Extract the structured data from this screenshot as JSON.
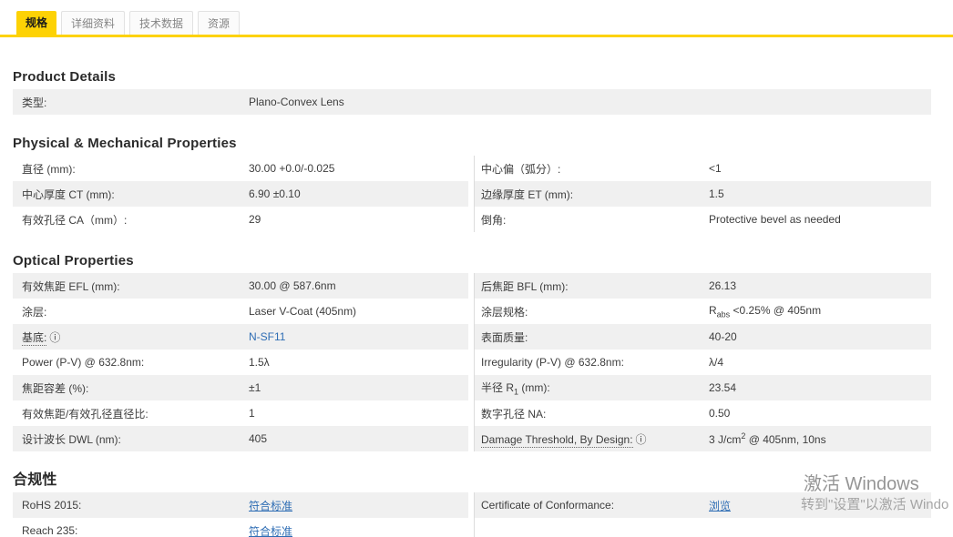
{
  "tabs": {
    "specs": "规格",
    "details": "详细资料",
    "tech_data": "技术数据",
    "resources": "资源"
  },
  "icons": {
    "info": "ⓘ"
  },
  "product_details": {
    "heading": "Product Details",
    "rows": [
      {
        "label": "类型:",
        "value": "Plano-Convex Lens"
      }
    ]
  },
  "physical": {
    "heading": "Physical & Mechanical Properties",
    "left": [
      {
        "label": "直径 (mm):",
        "value": "30.00 +0.0/-0.025"
      },
      {
        "label": "中心厚度 CT (mm):",
        "value": "6.90 ±0.10"
      },
      {
        "label": "有效孔径 CA（mm）:",
        "value": "29"
      }
    ],
    "right": [
      {
        "label": "中心偏（弧分）:",
        "value": "<1"
      },
      {
        "label": "边缘厚度 ET (mm):",
        "value": "1.5"
      },
      {
        "label": "倒角:",
        "value": "Protective bevel as needed"
      }
    ]
  },
  "optical": {
    "heading": "Optical Properties",
    "left": [
      {
        "label": "有效焦距 EFL (mm):",
        "value": "30.00 @ 587.6nm"
      },
      {
        "label": "涂层:",
        "value": "Laser V-Coat (405nm)"
      },
      {
        "label": "基底:",
        "value": "N-SF11"
      },
      {
        "label": "Power (P-V) @ 632.8nm:",
        "value": "1.5λ"
      },
      {
        "label": "焦距容差 (%):",
        "value": "±1"
      },
      {
        "label": "有效焦距/有效孔径直径比:",
        "value": "1"
      },
      {
        "label": "设计波长 DWL (nm):",
        "value": "405"
      }
    ],
    "right": [
      {
        "label": "后焦距 BFL (mm):",
        "value": "26.13"
      },
      {
        "label": "涂层规格:",
        "value_pre": "R",
        "value_sub": "abs",
        "value_post": " <0.25% @ 405nm"
      },
      {
        "label": "表面质量:",
        "value": "40-20"
      },
      {
        "label": "Irregularity (P-V) @ 632.8nm:",
        "value": "λ/4"
      },
      {
        "label_pre": "半径 R",
        "label_sub": "1",
        "label_post": " (mm):",
        "value": "23.54"
      },
      {
        "label": "数字孔径 NA:",
        "value": "0.50"
      },
      {
        "label": "Damage Threshold, By Design:",
        "value_pre": "3 J/cm",
        "value_sup": "2",
        "value_post": " @ 405nm, 10ns"
      }
    ]
  },
  "compliance": {
    "heading": "合规性",
    "left": [
      {
        "label": "RoHS 2015:",
        "value": "符合标准"
      },
      {
        "label": "Reach 235:",
        "value": "符合标准"
      }
    ],
    "right": [
      {
        "label": "Certificate of Conformance:",
        "value": "浏览"
      }
    ]
  },
  "watermark": {
    "line1": "激活 Windows",
    "line2": "转到\"设置\"以激活 Windo"
  }
}
